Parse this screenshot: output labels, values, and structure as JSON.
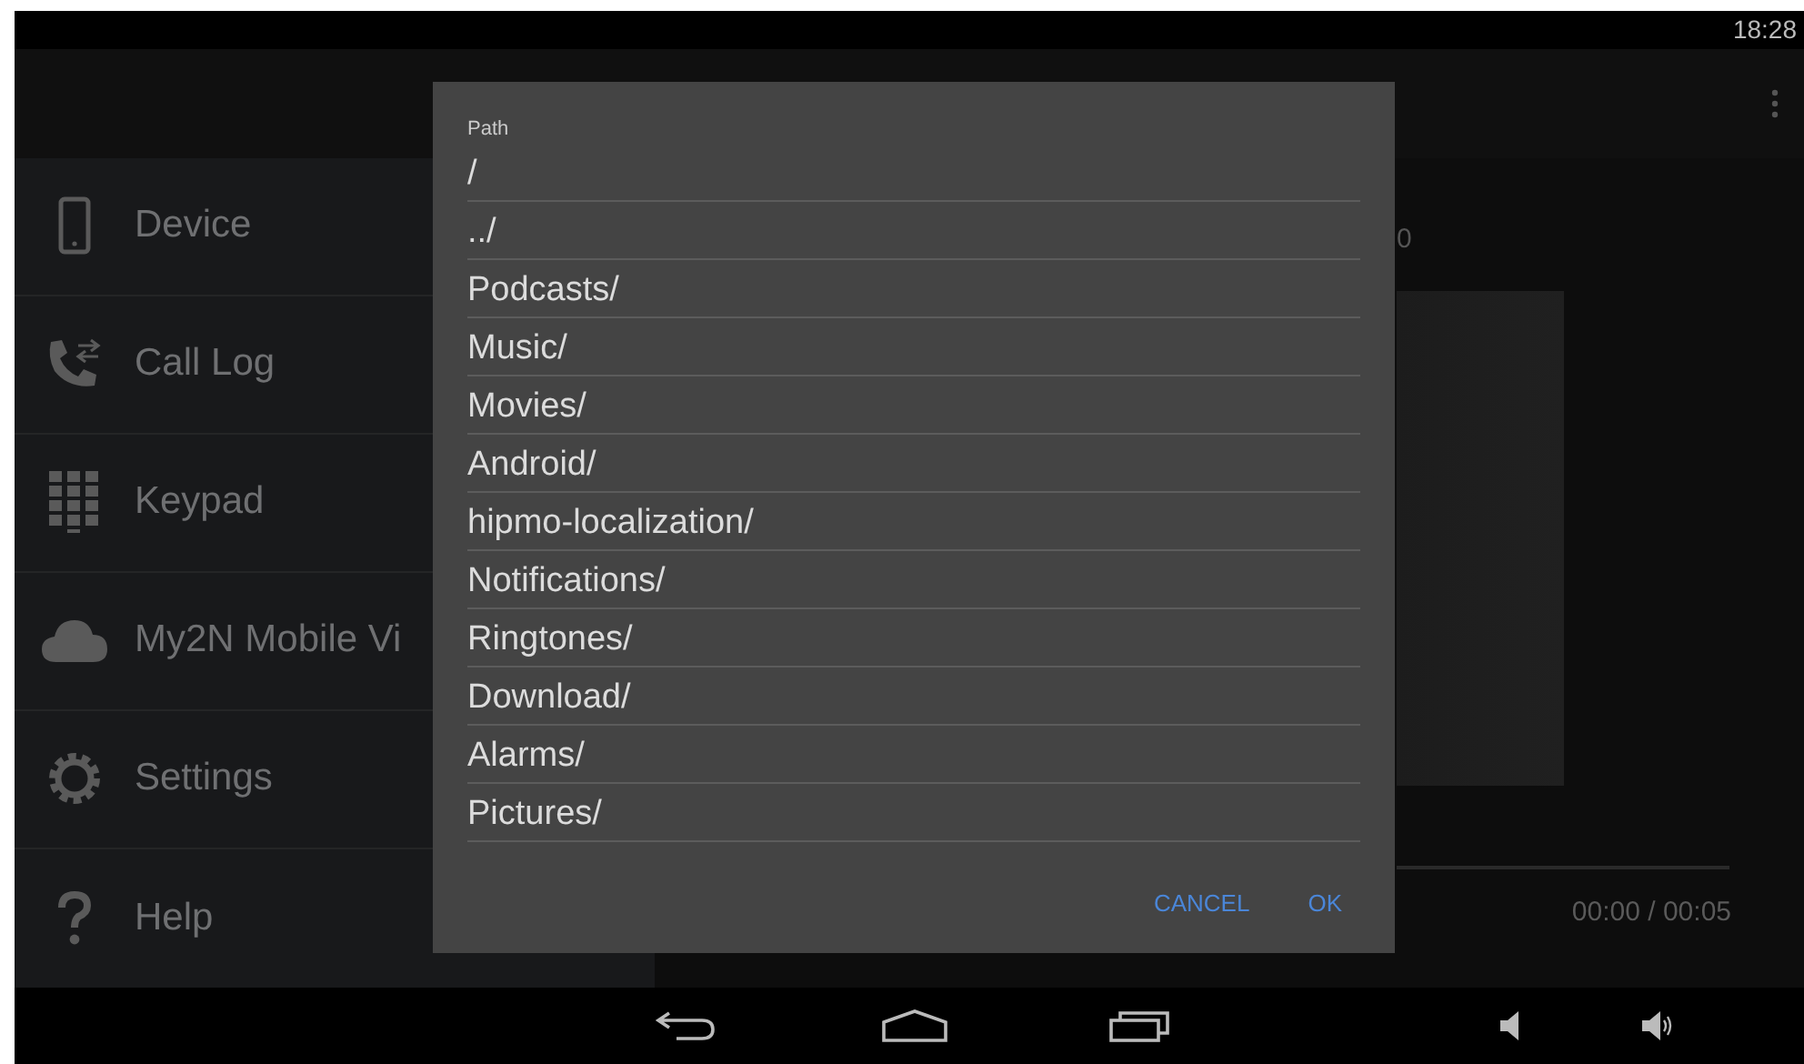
{
  "status_bar": {
    "time": "18:28"
  },
  "sidebar": {
    "items": [
      {
        "label": "Device"
      },
      {
        "label": "Call Log"
      },
      {
        "label": "Keypad"
      },
      {
        "label": "My2N Mobile Vi"
      },
      {
        "label": "Settings"
      },
      {
        "label": "Help"
      }
    ]
  },
  "content": {
    "title_fragment": "0",
    "player_time": "00:00 / 00:05"
  },
  "dialog": {
    "label": "Path",
    "entries": [
      "/",
      "../",
      "Podcasts/",
      "Music/",
      "Movies/",
      "Android/",
      "hipmo-localization/",
      "Notifications/",
      "Ringtones/",
      "Download/",
      "Alarms/",
      "Pictures/"
    ],
    "buttons": [
      "CANCEL",
      "OK"
    ]
  }
}
